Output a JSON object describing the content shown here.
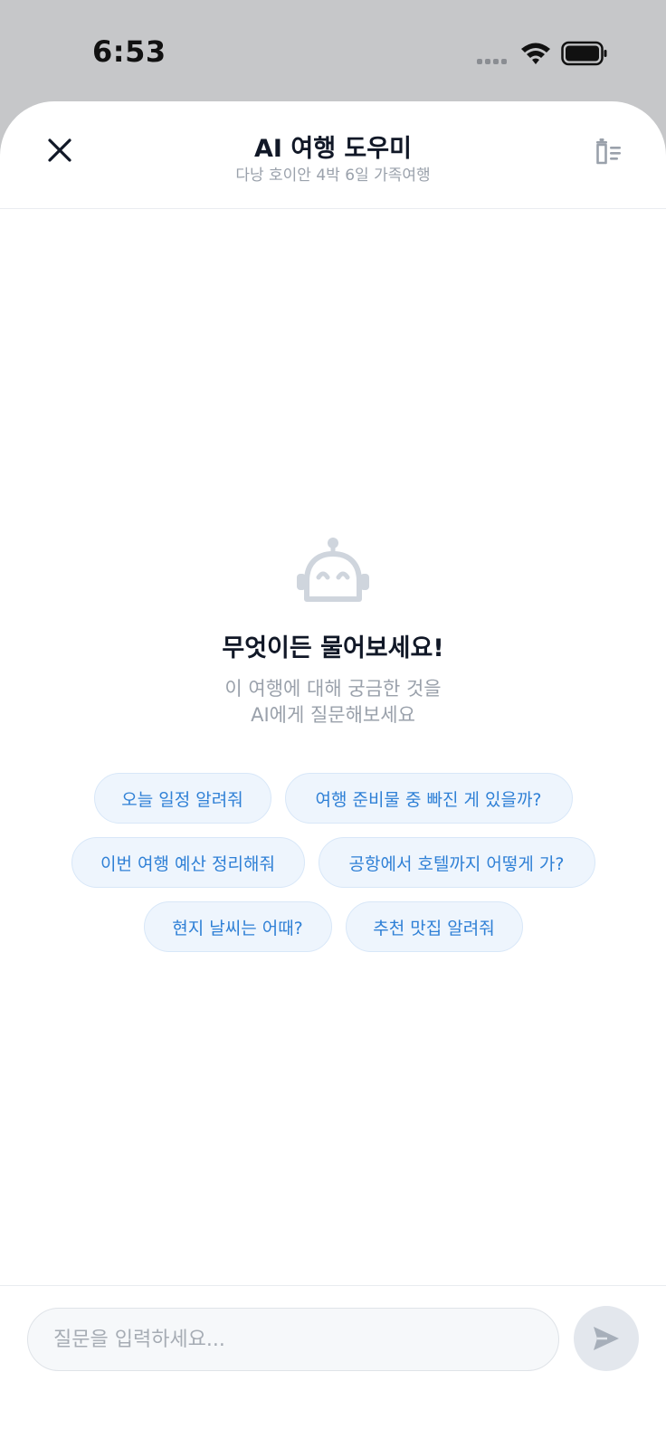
{
  "status_bar": {
    "time": "6:53"
  },
  "header": {
    "title": "AI 여행 도우미",
    "subtitle": "다낭 호이안 4박 6일 가족여행"
  },
  "empty_state": {
    "title": "무엇이든 물어보세요!",
    "description_line1": "이 여행에 대해 궁금한 것을",
    "description_line2": "AI에게 질문해보세요"
  },
  "suggestions": [
    [
      "오늘 일정 알려줘",
      "여행 준비물 중 빠진 게 있을까?"
    ],
    [
      "이번 여행 예산 정리해줘",
      "공항에서 호텔까지 어떻게 가?"
    ],
    [
      "현지 날씨는 어때?",
      "추천 맛집 알려줘"
    ]
  ],
  "input": {
    "placeholder": "질문을 입력하세요..."
  },
  "icons": {
    "close": "close-icon",
    "clear_history": "trash-list-icon",
    "robot": "robot-icon",
    "send": "send-icon"
  },
  "colors": {
    "accent": "#2f80d6",
    "chip_bg": "#eef5fd",
    "muted": "#9aa1ab",
    "icon_gray": "#cfd5dd"
  }
}
